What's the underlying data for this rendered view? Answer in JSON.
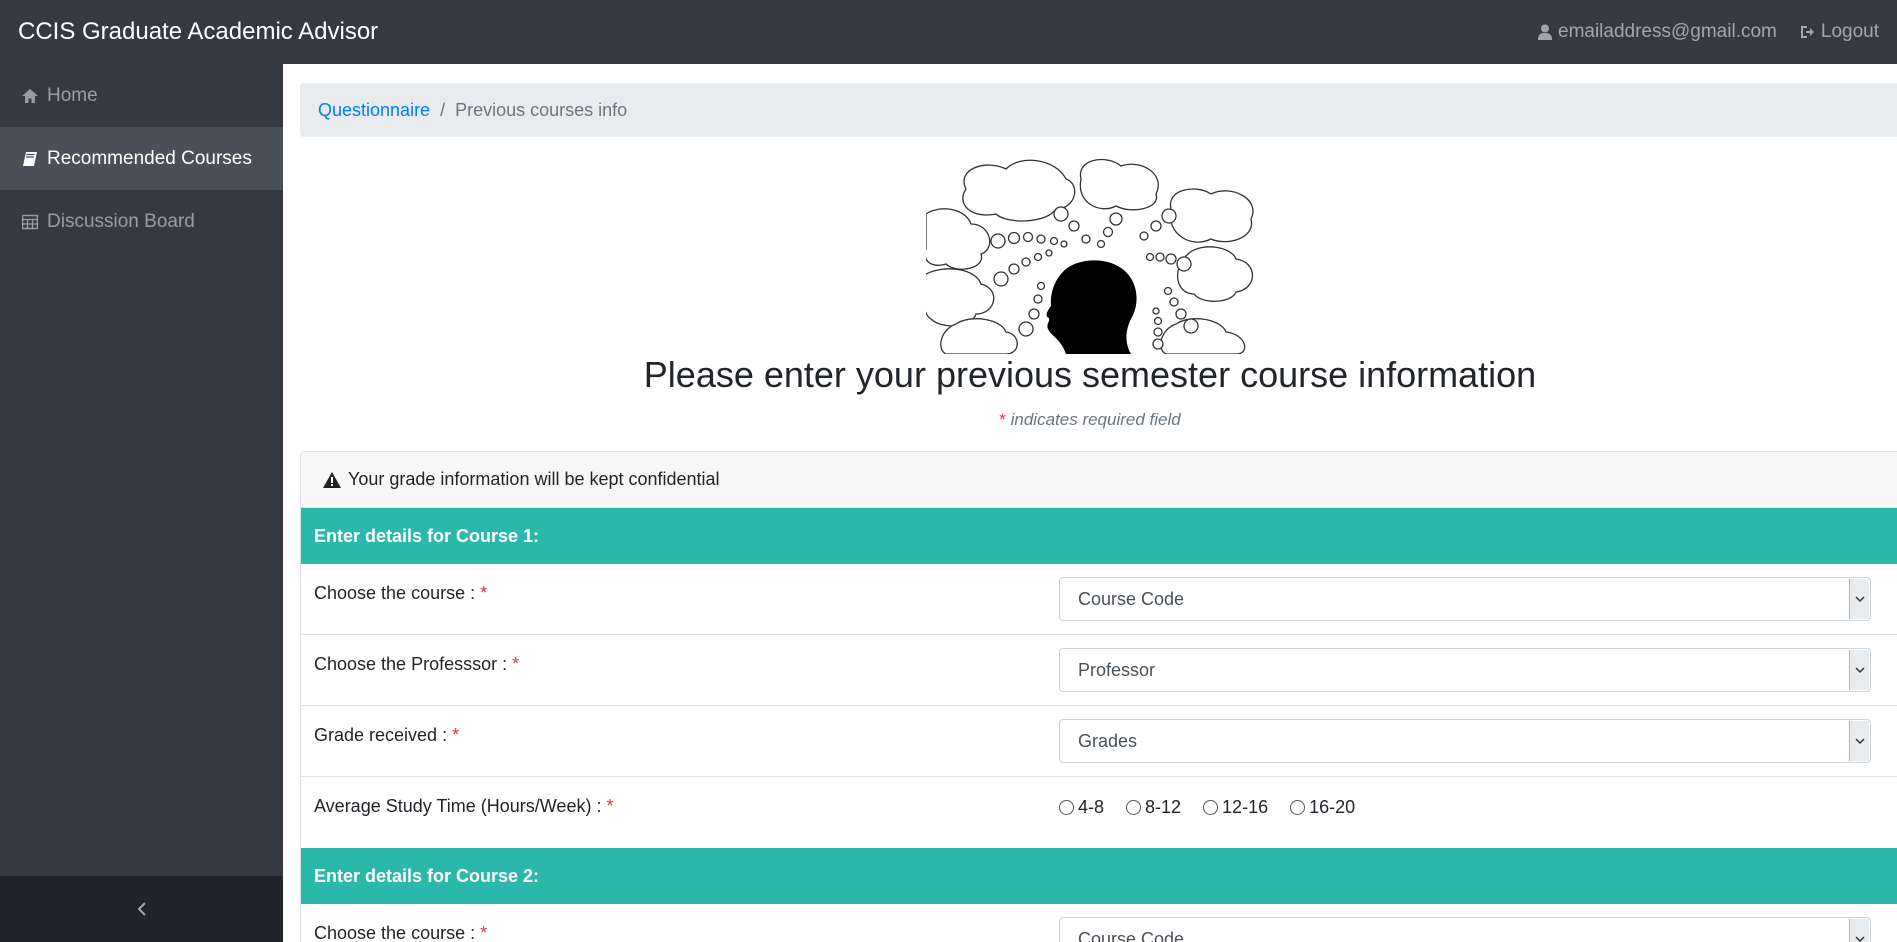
{
  "navbar": {
    "brand": "CCIS Graduate Academic Advisor",
    "email": "emailaddress@gmail.com",
    "logout": "Logout"
  },
  "sidebar": {
    "items": [
      {
        "label": "Home",
        "icon": "home-icon"
      },
      {
        "label": "Recommended Courses",
        "icon": "book-icon",
        "active": true
      },
      {
        "label": "Discussion Board",
        "icon": "table-icon"
      }
    ],
    "toggle_icon": "chevron-left-icon"
  },
  "breadcrumb": {
    "link": "Questionnaire",
    "separator": "/",
    "current": "Previous courses info"
  },
  "page": {
    "title": "Please enter your previous semester course information",
    "required_star": "*",
    "required_note": "indicates required field",
    "notice": "Your grade information will be kept confidential"
  },
  "courses": [
    {
      "header": "Enter details for Course 1:",
      "course_label": "Choose the course :",
      "course_value": "Course Code",
      "professor_label": "Choose the Professsor :",
      "professor_value": "Professor",
      "grade_label": "Grade received :",
      "grade_value": "Grades",
      "study_label": "Average Study Time (Hours/Week) :",
      "study_options": [
        "4-8",
        "8-12",
        "12-16",
        "16-20"
      ]
    },
    {
      "header": "Enter details for Course 2:",
      "course_label": "Choose the course :",
      "course_value": "Course Code"
    }
  ],
  "colors": {
    "navbar": "#343a40",
    "accent": "#2ab8ab",
    "link": "#007bff",
    "required": "#dc3545"
  }
}
